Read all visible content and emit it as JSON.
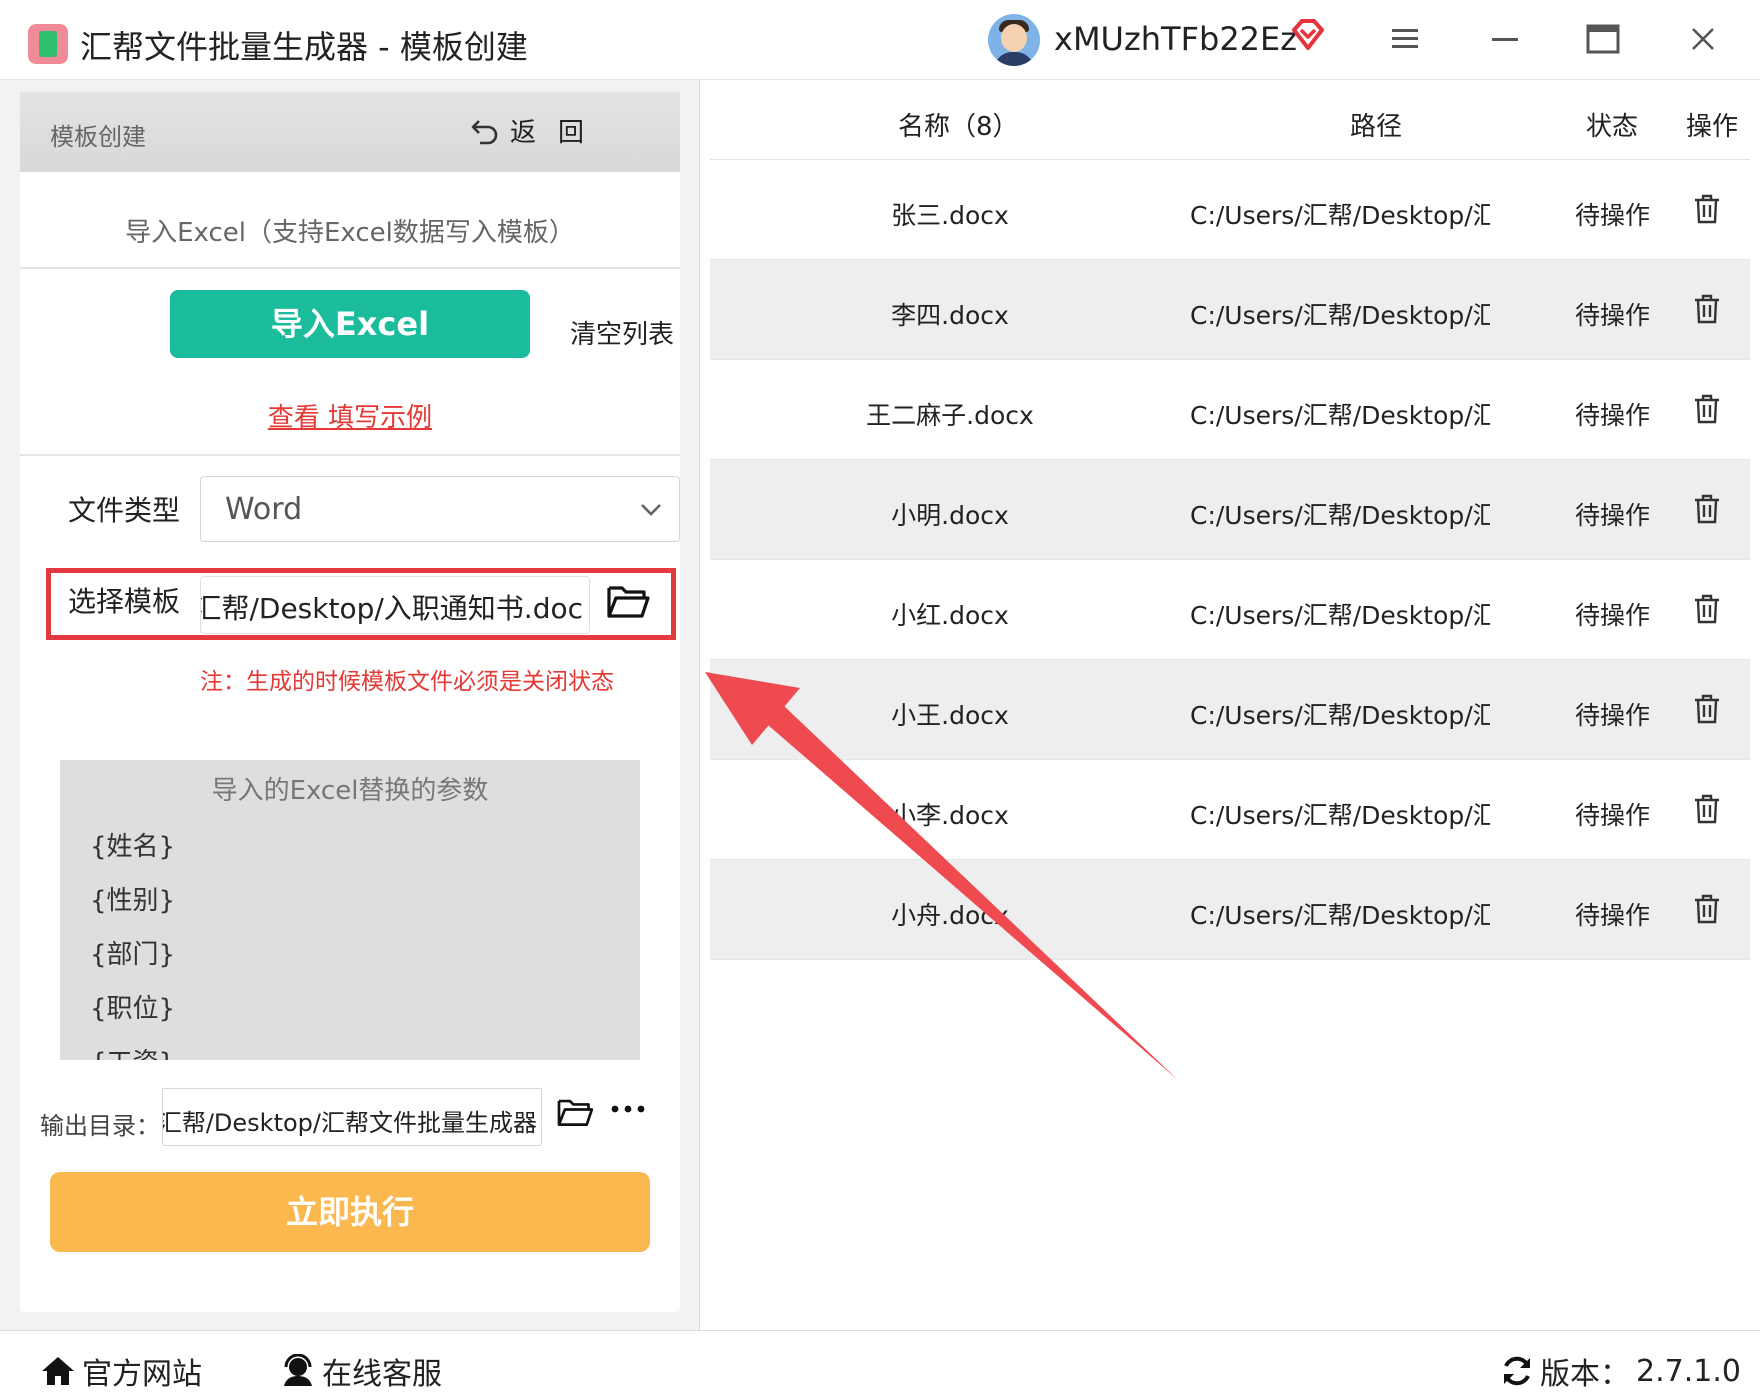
{
  "app": {
    "title": "汇帮文件批量生成器 - 模板创建",
    "username": "xMUzhTFb22Ez"
  },
  "left": {
    "header_title": "模板创建",
    "back_label": "返回",
    "import_title": "导入Excel（支持Excel数据写入模板）",
    "import_button": "导入Excel",
    "clear_button": "清空列表",
    "example_link": "查看 填写示例",
    "file_type_label": "文件类型",
    "file_type_value": "Word",
    "template_label": "选择模板",
    "template_path": "汇帮/Desktop/入职通知书.doc",
    "template_note": "注：生成的时候模板文件必须是关闭状态",
    "params_title": "导入的Excel替换的参数",
    "params": [
      "{姓名}",
      "{性别}",
      "{部门}",
      "{职位}",
      "{工资}"
    ],
    "output_label": "输出目录：",
    "output_path": "汇帮/Desktop/汇帮文件批量生成器",
    "execute_button": "立即执行"
  },
  "table": {
    "headers": {
      "name": "名称（8）",
      "path": "路径",
      "status": "状态",
      "action": "操作"
    },
    "rows": [
      {
        "name": "张三.docx",
        "path": "C:/Users/汇帮/Desktop/汇帮文件",
        "status": "待操作"
      },
      {
        "name": "李四.docx",
        "path": "C:/Users/汇帮/Desktop/汇帮文件",
        "status": "待操作"
      },
      {
        "name": "王二麻子.docx",
        "path": "C:/Users/汇帮/Desktop/汇帮文件",
        "status": "待操作"
      },
      {
        "name": "小明.docx",
        "path": "C:/Users/汇帮/Desktop/汇帮文件",
        "status": "待操作"
      },
      {
        "name": "小红.docx",
        "path": "C:/Users/汇帮/Desktop/汇帮文件",
        "status": "待操作"
      },
      {
        "name": "小王.docx",
        "path": "C:/Users/汇帮/Desktop/汇帮文件",
        "status": "待操作"
      },
      {
        "name": "小李.docx",
        "path": "C:/Users/汇帮/Desktop/汇帮文件",
        "status": "待操作"
      },
      {
        "name": "小舟.docx",
        "path": "C:/Users/汇帮/Desktop/汇帮文件",
        "status": "待操作"
      }
    ]
  },
  "statusbar": {
    "website": "官方网站",
    "support": "在线客服",
    "version_label": "版本：",
    "version": "2.7.1.0"
  },
  "icons": {
    "logo": "app-logo-icon",
    "vip": "vip-diamond-icon",
    "menu": "menu-icon",
    "minimize": "minimize-icon",
    "maximize": "maximize-icon",
    "close": "close-icon",
    "back": "back-arrow-icon",
    "dropdown": "chevron-down-icon",
    "folder": "folder-icon",
    "more": "more-icon",
    "delete": "trash-icon",
    "home": "home-icon",
    "support": "headset-icon",
    "refresh": "refresh-icon"
  },
  "colors": {
    "primary_green": "#1abc9c",
    "execute_orange": "#fbb84f",
    "highlight_red": "#e53940",
    "link_red": "#e53935",
    "vip_red": "#e8323c"
  }
}
